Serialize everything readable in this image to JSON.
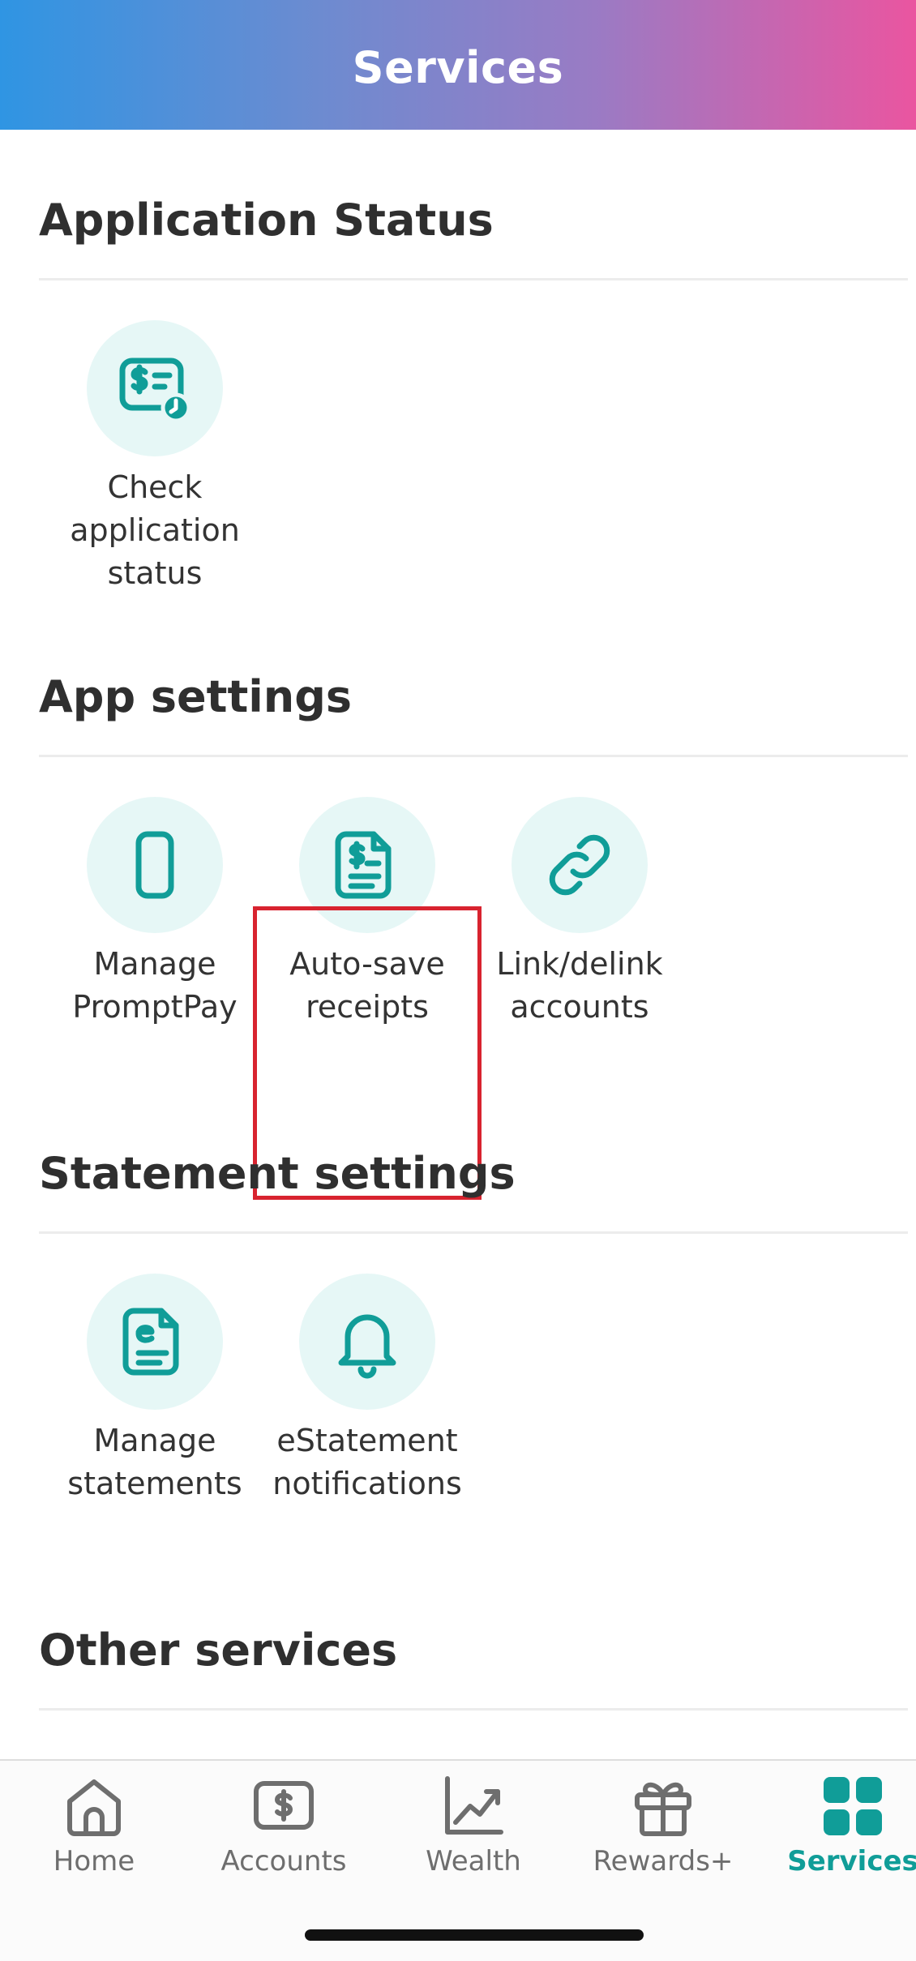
{
  "header": {
    "title": "Services"
  },
  "sections": {
    "application_status": {
      "title": "Application Status",
      "items": [
        {
          "label": "Check\napplication\nstatus",
          "icon": "bill-clock-icon"
        }
      ]
    },
    "app_settings": {
      "title": "App settings",
      "items": [
        {
          "label": "Manage\nPromptPay",
          "icon": "phone-icon"
        },
        {
          "label": "Auto-save\nreceipts",
          "icon": "receipt-icon"
        },
        {
          "label": "Link/delink\naccounts",
          "icon": "link-icon"
        }
      ]
    },
    "statement_settings": {
      "title": "Statement settings",
      "items": [
        {
          "label": "Manage\nstatements",
          "icon": "e-document-icon"
        },
        {
          "label": "eStatement\nnotifications",
          "icon": "bell-icon"
        }
      ]
    },
    "other_services": {
      "title": "Other services"
    }
  },
  "tabbar": {
    "tabs": [
      {
        "label": "Home",
        "icon": "home-icon"
      },
      {
        "label": "Accounts",
        "icon": "accounts-icon"
      },
      {
        "label": "Wealth",
        "icon": "chart-icon"
      },
      {
        "label": "Rewards+",
        "icon": "gift-icon"
      },
      {
        "label": "Services",
        "icon": "grid-icon",
        "active": true
      }
    ]
  },
  "colors": {
    "accent": "#109d98",
    "icon_bg": "#e6f7f6",
    "highlight": "#d8232f"
  }
}
